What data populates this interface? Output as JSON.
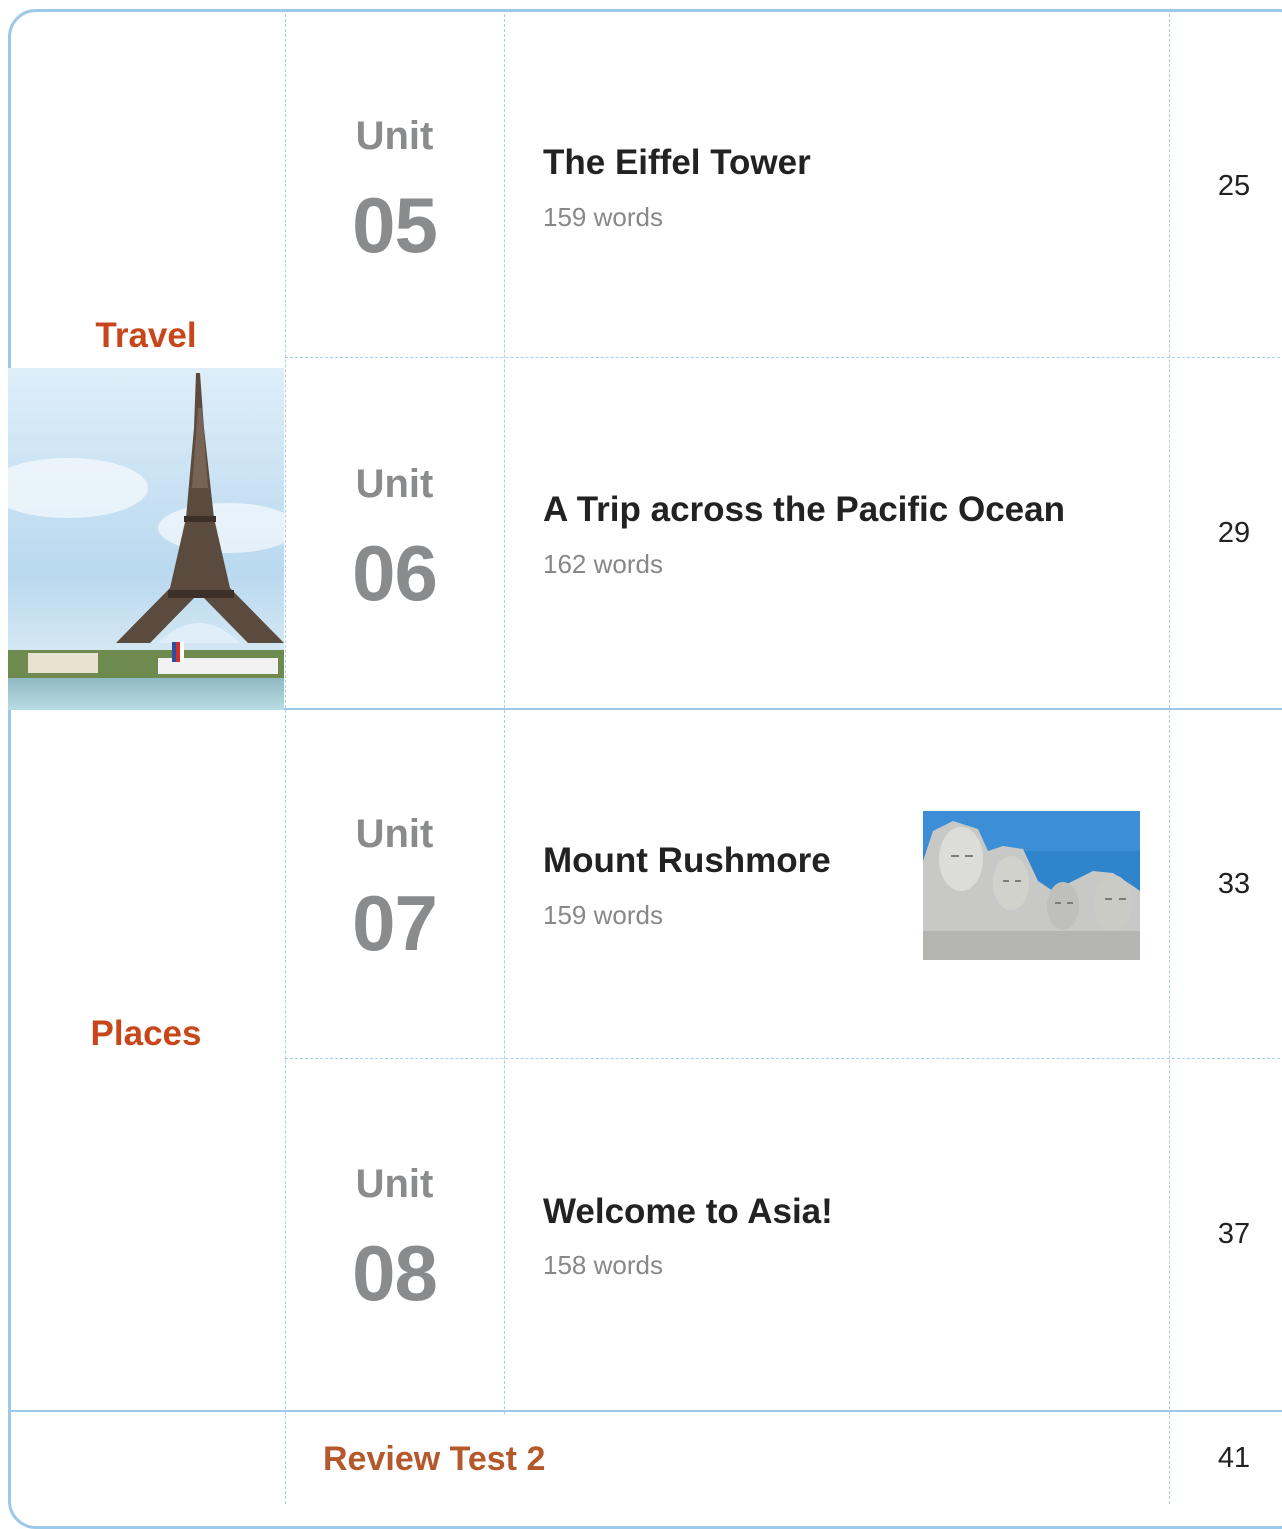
{
  "themes": {
    "travel": "Travel",
    "places": "Places"
  },
  "units": [
    {
      "label": "Unit",
      "number": "05",
      "title": "The Eiffel Tower",
      "words": "159 words",
      "page": "25"
    },
    {
      "label": "Unit",
      "number": "06",
      "title": "A Trip across the Pacific Ocean",
      "words": "162 words",
      "page": "29"
    },
    {
      "label": "Unit",
      "number": "07",
      "title": "Mount Rushmore",
      "words": "159 words",
      "page": "33"
    },
    {
      "label": "Unit",
      "number": "08",
      "title": "Welcome to Asia!",
      "words": "158 words",
      "page": "37"
    }
  ],
  "review": {
    "label": "Review Test 2",
    "page": "41"
  },
  "colors": {
    "theme": "#c8471a",
    "review": "#b5582b",
    "unit": "#8a8b8d",
    "border": "#9cc8ea"
  },
  "images": {
    "travel": "eiffel-tower-photo",
    "unit07": "mount-rushmore-photo"
  }
}
